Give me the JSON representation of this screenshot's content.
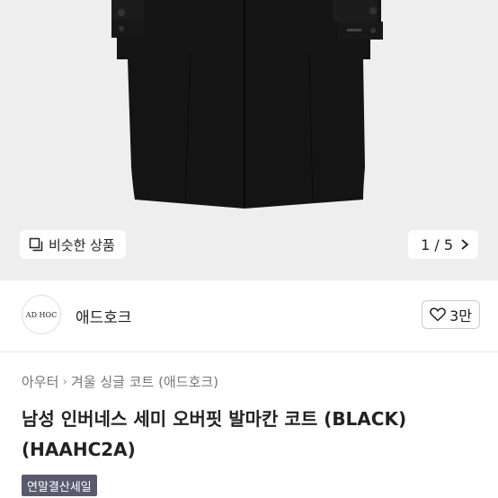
{
  "image_viewer": {
    "similar_button_label": "비슷한 상품",
    "pager_text": "1 / 5",
    "background_color": "#eeeeee",
    "product_color": "#141414"
  },
  "shop": {
    "logo_text": "AD HOC",
    "name": "애드호크",
    "likes_label": "3만"
  },
  "product": {
    "breadcrumb": [
      "아우터",
      "겨울 싱글 코트 (애드호크)"
    ],
    "title": "남성 인버네스 세미 오버핏 발마칸 코트 (BLACK) (HAAHC2A)",
    "badge": "연말결산세일"
  }
}
